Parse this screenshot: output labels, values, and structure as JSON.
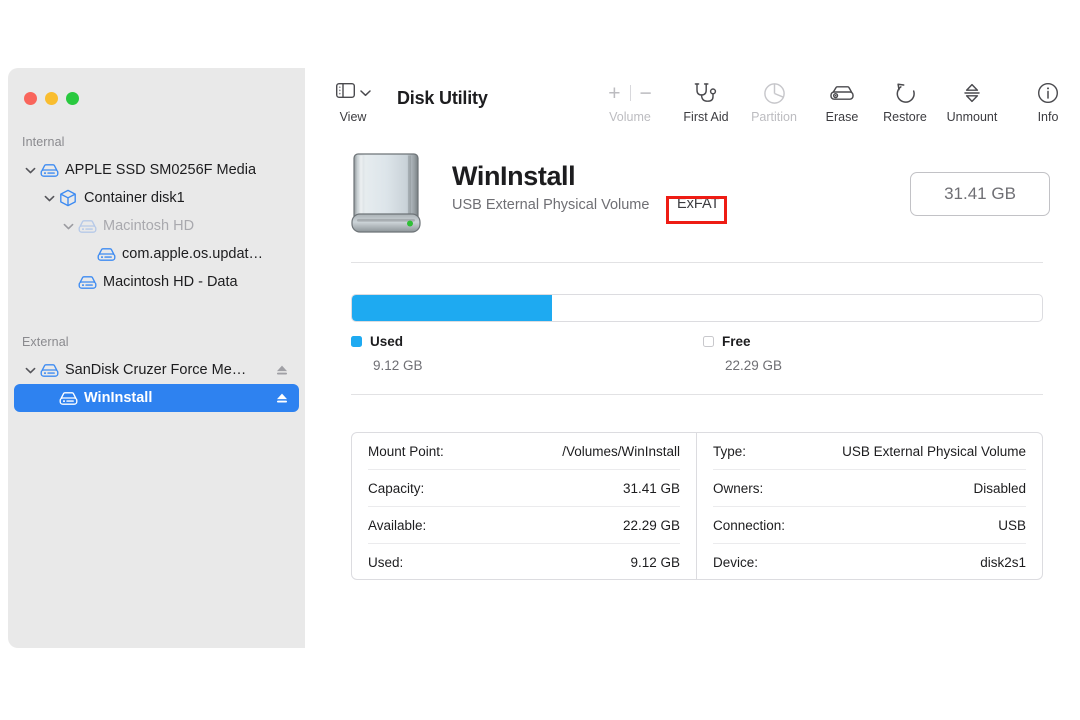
{
  "window": {
    "traffic_lights": [
      "close",
      "minimize",
      "zoom"
    ]
  },
  "sidebar": {
    "sections": [
      {
        "header": "Internal",
        "items": [
          {
            "label": "APPLE SSD SM0256F Media",
            "icon": "drive-icon",
            "indent": 0,
            "twisty": "down",
            "dim": false,
            "eject": false,
            "selected": false
          },
          {
            "label": "Container disk1",
            "icon": "container-box-icon",
            "indent": 1,
            "twisty": "down",
            "dim": false,
            "eject": false,
            "selected": false
          },
          {
            "label": "Macintosh HD",
            "icon": "drive-icon",
            "indent": 2,
            "twisty": "down",
            "dim": true,
            "eject": false,
            "selected": false
          },
          {
            "label": "com.apple.os.updat…",
            "icon": "drive-icon",
            "indent": 3,
            "twisty": "none",
            "dim": false,
            "eject": false,
            "selected": false
          },
          {
            "label": "Macintosh HD - Data",
            "icon": "drive-icon",
            "indent": 2,
            "twisty": "none",
            "dim": false,
            "eject": false,
            "selected": false
          }
        ]
      },
      {
        "header": "External",
        "items": [
          {
            "label": "SanDisk Cruzer Force Me…",
            "icon": "drive-icon",
            "indent": 0,
            "twisty": "down",
            "dim": false,
            "eject": true,
            "selected": false
          },
          {
            "label": "WinInstall",
            "icon": "drive-icon",
            "indent": 1,
            "twisty": "none",
            "dim": false,
            "eject": true,
            "selected": true
          }
        ]
      }
    ]
  },
  "toolbar": {
    "view_label": "View",
    "view_icon": "sidebar-layout-icon",
    "view_chevron_icon": "chevron-down-icon",
    "app_title": "Disk Utility",
    "volume": {
      "label": "Volume",
      "plus": "+",
      "minus": "−",
      "disabled": true
    },
    "items": [
      {
        "label": "First Aid",
        "icon": "stethoscope-icon",
        "disabled": false
      },
      {
        "label": "Partition",
        "icon": "pie-chart-icon",
        "disabled": true
      },
      {
        "label": "Erase",
        "icon": "erase-disk-icon",
        "disabled": false
      },
      {
        "label": "Restore",
        "icon": "restore-arrow-icon",
        "disabled": false
      },
      {
        "label": "Unmount",
        "icon": "unmount-arrows-icon",
        "disabled": false
      },
      {
        "label": "Info",
        "icon": "info-circle-icon",
        "disabled": false
      }
    ]
  },
  "volume_header": {
    "icon": "external-drive-icon",
    "name": "WinInstall",
    "subtitle": "USB External Physical Volume",
    "filesystem": "ExFAT",
    "filesystem_highlighted": true,
    "highlight_color": "#ee1c14",
    "capacity_badge": "31.41 GB"
  },
  "usage": {
    "used_percent": 29,
    "used_label": "Used",
    "used_value": "9.12 GB",
    "free_label": "Free",
    "free_value": "22.29 GB",
    "used_color": "#1eaaf1",
    "free_color": "#ffffff"
  },
  "info_table": {
    "left": [
      {
        "key": "Mount Point:",
        "value": "/Volumes/WinInstall"
      },
      {
        "key": "Capacity:",
        "value": "31.41 GB"
      },
      {
        "key": "Available:",
        "value": "22.29 GB"
      },
      {
        "key": "Used:",
        "value": "9.12 GB"
      }
    ],
    "right": [
      {
        "key": "Type:",
        "value": "USB External Physical Volume"
      },
      {
        "key": "Owners:",
        "value": "Disabled"
      },
      {
        "key": "Connection:",
        "value": "USB"
      },
      {
        "key": "Device:",
        "value": "disk2s1"
      }
    ]
  }
}
